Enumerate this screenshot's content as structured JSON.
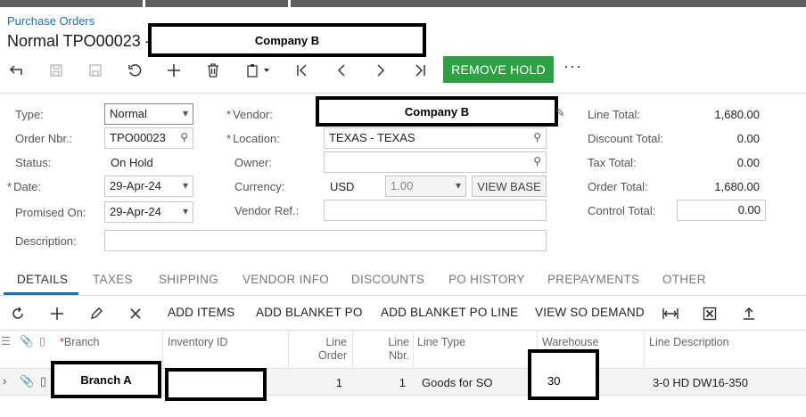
{
  "header": {
    "breadcrumb": "Purchase Orders",
    "title": "Normal TPO00023 -",
    "vendor_redacted": "Company B"
  },
  "toolbar": {
    "remove_hold": "REMOVE HOLD",
    "more": "···"
  },
  "form": {
    "type_label": "Type:",
    "type_value": "Normal",
    "order_nbr_label": "Order Nbr.:",
    "order_nbr_value": "TPO00023",
    "status_label": "Status:",
    "status_value": "On Hold",
    "date_label": "Date:",
    "date_value": "29-Apr-24",
    "promised_label": "Promised On:",
    "promised_value": "29-Apr-24",
    "description_label": "Description:",
    "description_value": "",
    "vendor_label": "Vendor:",
    "vendor_value": "Company B",
    "location_label": "Location:",
    "location_value": "TEXAS - TEXAS",
    "owner_label": "Owner:",
    "owner_value": "",
    "currency_label": "Currency:",
    "currency_value": "USD",
    "currency_rate": "1.00",
    "view_base": "VIEW BASE",
    "vendor_ref_label": "Vendor Ref.:",
    "vendor_ref_value": "",
    "line_total_label": "Line Total:",
    "line_total_value": "1,680.00",
    "discount_total_label": "Discount Total:",
    "discount_total_value": "0.00",
    "tax_total_label": "Tax Total:",
    "tax_total_value": "0.00",
    "order_total_label": "Order Total:",
    "order_total_value": "1,680.00",
    "control_total_label": "Control Total:",
    "control_total_value": "0.00"
  },
  "tabs": [
    "DETAILS",
    "TAXES",
    "SHIPPING",
    "VENDOR INFO",
    "DISCOUNTS",
    "PO HISTORY",
    "PREPAYMENTS",
    "OTHER"
  ],
  "grid_toolbar": {
    "add_items": "ADD ITEMS",
    "add_blanket_po": "ADD BLANKET PO",
    "add_blanket_po_line": "ADD BLANKET PO LINE",
    "view_so_demand": "VIEW SO DEMAND"
  },
  "grid": {
    "headers": {
      "branch": "Branch",
      "inventory_id": "Inventory ID",
      "line_order_1": "Line",
      "line_order_2": "Order",
      "line_nbr_1": "Line",
      "line_nbr_2": "Nbr.",
      "line_type": "Line Type",
      "warehouse": "Warehouse",
      "line_description": "Line Description"
    },
    "rows": [
      {
        "branch": "Branch A",
        "inventory_id": "",
        "line_order": "1",
        "line_nbr": "1",
        "line_type": "Goods for SO",
        "warehouse": "30",
        "line_description": "3-0 HD DW16-350"
      }
    ]
  }
}
